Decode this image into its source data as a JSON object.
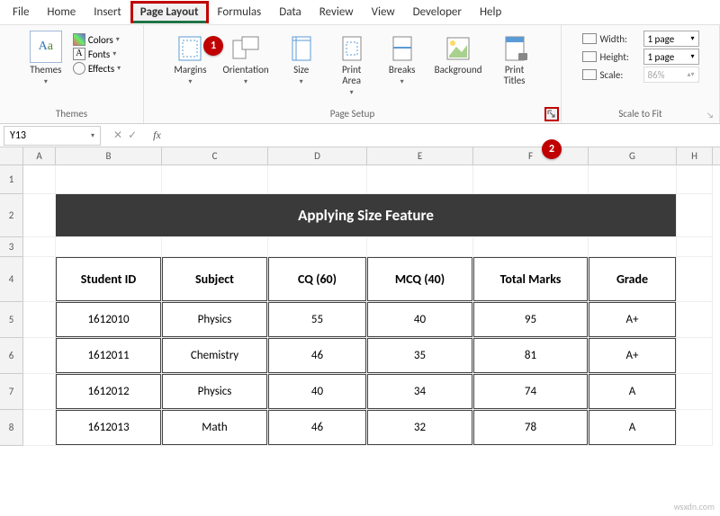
{
  "menu": [
    "File",
    "Home",
    "Insert",
    "Page Layout",
    "Formulas",
    "Data",
    "Review",
    "View",
    "Developer",
    "Help"
  ],
  "menu_active_index": 3,
  "callouts": {
    "one": "1",
    "two": "2"
  },
  "ribbon": {
    "themes": {
      "label": "Themes",
      "themes_btn": "Themes",
      "colors": "Colors",
      "fonts": "Fonts",
      "effects": "Effects"
    },
    "page_setup": {
      "label": "Page Setup",
      "margins": "Margins",
      "orientation": "Orientation",
      "size": "Size",
      "print_area": "Print\nArea",
      "breaks": "Breaks",
      "background": "Background",
      "print_titles": "Print\nTitles"
    },
    "scale": {
      "label": "Scale to Fit",
      "width_label": "Width:",
      "height_label": "Height:",
      "scale_label": "Scale:",
      "width_val": "1 page",
      "height_val": "1 page",
      "scale_val": "86%"
    }
  },
  "namebox": "Y13",
  "fx": "fx",
  "sheet": {
    "columns": [
      "A",
      "B",
      "C",
      "D",
      "E",
      "F",
      "G",
      "H"
    ],
    "title": "Applying Size Feature",
    "headers": [
      "Student ID",
      "Subject",
      "CQ  (60)",
      "MCQ  (40)",
      "Total Marks",
      "Grade"
    ],
    "rows": [
      [
        "1612010",
        "Physics",
        "55",
        "40",
        "95",
        "A+"
      ],
      [
        "1612011",
        "Chemistry",
        "46",
        "35",
        "81",
        "A+"
      ],
      [
        "1612012",
        "Physics",
        "40",
        "34",
        "74",
        "A"
      ],
      [
        "1612013",
        "Math",
        "46",
        "32",
        "78",
        "A"
      ]
    ],
    "row_numbers": [
      "1",
      "2",
      "3",
      "4",
      "5",
      "6",
      "7",
      "8"
    ]
  },
  "watermark": "wsxdn.com"
}
